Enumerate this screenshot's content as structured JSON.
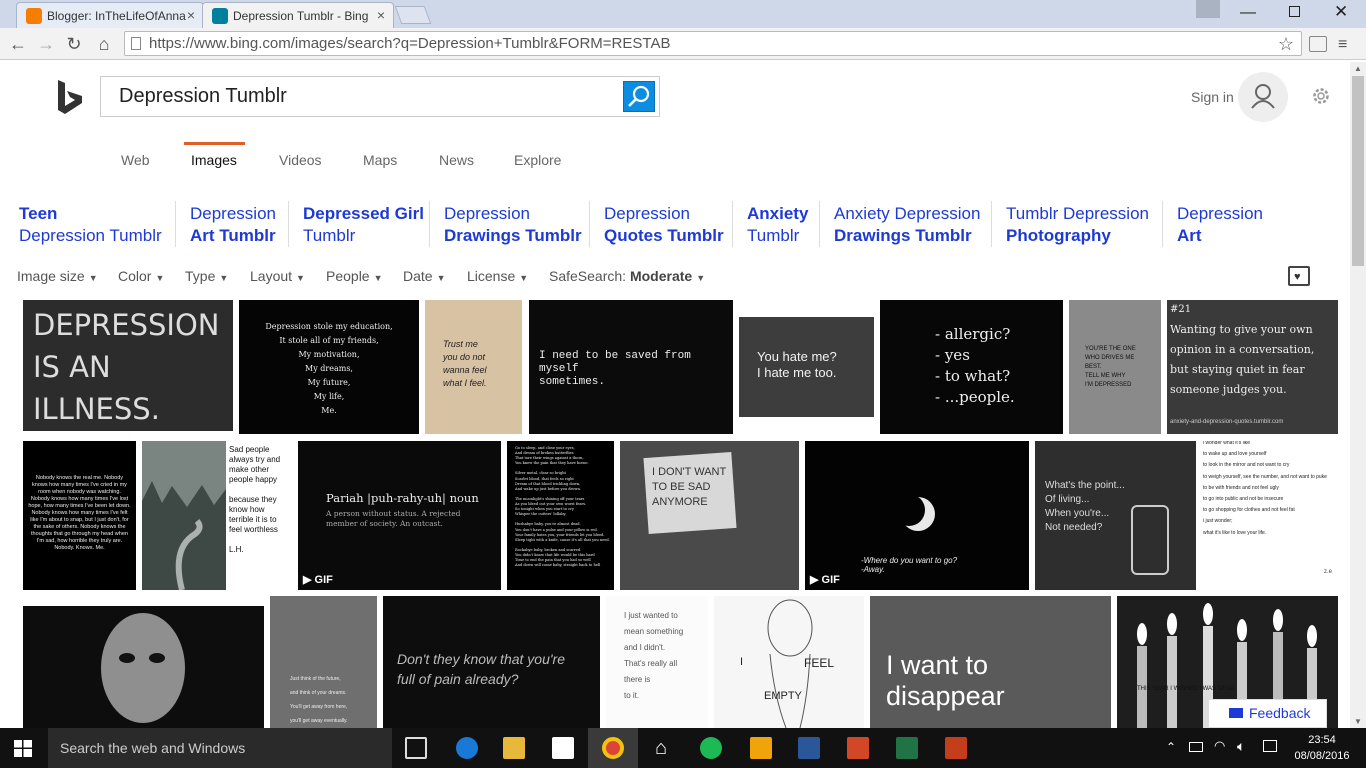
{
  "browser": {
    "tabs": [
      {
        "title": "Blogger: InTheLifeOfAnna",
        "icon": "blogger-icon",
        "color": "#f57d00"
      },
      {
        "title": "Depression Tumblr - Bing",
        "icon": "bing-icon",
        "color": "#00809d"
      }
    ],
    "url": "https://www.bing.com/images/search?q=Depression+Tumblr&FORM=RESTAB"
  },
  "bing": {
    "query": "Depression Tumblr",
    "signin": "Sign in",
    "scopes": [
      "Web",
      "Images",
      "Videos",
      "Maps",
      "News",
      "Explore"
    ],
    "active_scope": "Images",
    "accent": "#e05e2a",
    "link_color": "#1e3ad6"
  },
  "related": [
    {
      "l1": "Teen",
      "l2": "Depression Tumblr"
    },
    {
      "l1": "Depression",
      "l2": "Art Tumblr"
    },
    {
      "l1": "Depressed Girl",
      "l2": "Tumblr"
    },
    {
      "l1": "Depression",
      "l2": "Drawings Tumblr"
    },
    {
      "l1": "Depression",
      "l2": "Quotes Tumblr"
    },
    {
      "l1": "Anxiety",
      "l2": "Tumblr"
    },
    {
      "l1": "Anxiety Depression",
      "l2": "Drawings Tumblr"
    },
    {
      "l1": "Tumblr Depression",
      "l2": "Photography"
    },
    {
      "l1": "Depression",
      "l2": "Art"
    }
  ],
  "filters": {
    "image_size": "Image size",
    "color": "Color",
    "type": "Type",
    "layout": "Layout",
    "people": "People",
    "date": "Date",
    "license": "License",
    "safesearch_label": "SafeSearch:",
    "safesearch_value": "Moderate"
  },
  "images": {
    "t1": "DEPRESSION IS AN\nILLNESS.\nNOT A CHOICE",
    "t2": "Depression stole my education,\nIt stole all of my friends,\nMy motivation,\nMy dreams,\nMy future,\nMy life,\nMe.",
    "t3": "Trust me\nyou do not\nwanna feel\nwhat I feel.",
    "t4": "I need to be saved from myself\nsometimes.",
    "t5": "You hate me?\nI hate me too.",
    "t6": "- allergic?\n- yes\n- to what?\n- ...people.",
    "t7": "YOU'RE THE ONE\nWHO DRIVES ME\nBEST.\nTELL ME WHY\nI'M DEPRESSED",
    "t8a": "#21",
    "t8": "Wanting to give your own opinion in a conversation, but staying quiet in fear someone judges you.",
    "t8s": "anxiety-and-depression-quotes.tumblr.com",
    "t9": "Nobody knows the real me. Nobody knows how many times I've cried in my room when nobody was watching. Nobody knows how many times I've lost hope, how many times I've been let down. Nobody knows how many times I've felt like I'm about to snap, but I just don't, for the sake of others. Nobody knows the thoughts that go through my head when I'm sad, how horrible they truly are.\nNobody. Knows. Me.",
    "t10": "Sad people always try and make other people happy\n\nbecause they know how terrible it is to feel worthless\n\nL.H.",
    "t11": "Pariah |puh-rahy-uh| noun",
    "t11b": "A person without status. A rejected member of society. An outcast.",
    "gif": "GIF",
    "t12": "Go to sleep, and close your eyes,\nAnd dream of broken butterflies\nThat tore their wings against a thorn,\nYou knew the pain that they have borne.\n\nSilver metal, clear so bright\nScarlet blood, that feels so right\nDream of that blood trickling down,\nAnd wake up just before you drown.\n\nThe moonlight's shining off your tears\nAs you bleed out your own worst fears.\nSo tonight when you start to cry\nWhisper the cutters' lullaby.\n\nHushabye baby, you're almost dead.\nYou don't have a pulse and your pillow is red.\nYour family hates you, your friends let you bleed.\nSleep tight with a knife, cause it's all that you need.\n\nRockabye baby, broken and scarred.\nYou didn't know that life would be this hard\nTime to end the pain that you had so well\nAnd down will come baby, straight back to hell",
    "t13": "I DON'T WANT\nTO BE SAD\nANYMORE",
    "t14": "-Where do you want to go?\n-Away.",
    "t15": "What's the point...\nOf living...\nWhen you're...\nNot needed?",
    "t16": "i wonder what it's like\n\nto wake up and love yourself\n\nto look in the mirror and not want to cry\n\nto weigh yourself, see the number, and not want to puke\n\nto be with friends and not feel ugly\n\nto go into public and not be insecure\n\nto go shopping for clothes and not feel fat\n\ni just wonder;\n\nwhat it's like to love your life.",
    "t16s": "z.e",
    "t17": "Just think of the future,\n\nand think of your dreams.\n\nYou'll get away from here,\n\nyou'll get away eventually.",
    "t18": "Don't they know that you're\nfull of pain already?",
    "t19": "I just wanted to\nmean something\nand I didn't.\nThat's really all\nthere is\nto it.",
    "t20a": "I",
    "t20b": "FEEL",
    "t20c": "EMPTY",
    "t21": "I want to disappear",
    "t22": "THIS YEAR I WISHED I WAS DEAD"
  },
  "feedback": "Feedback",
  "taskbar": {
    "search_placeholder": "Search the web and Windows",
    "time": "23:54",
    "date": "08/08/2016"
  }
}
